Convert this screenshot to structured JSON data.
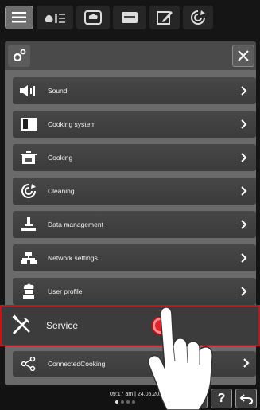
{
  "tabs": [
    {
      "name": "menu-list-tab",
      "active": true
    },
    {
      "name": "cooking-paths-tab",
      "active": false
    },
    {
      "name": "programs-tab",
      "active": false
    },
    {
      "name": "cookbook-tab",
      "active": false
    },
    {
      "name": "edit-tab",
      "active": false
    },
    {
      "name": "cleaning-tab",
      "active": false
    }
  ],
  "menu": {
    "items": [
      {
        "label": "Sound",
        "icon": "speaker-icon"
      },
      {
        "label": "Cooking system",
        "icon": "oven-icon"
      },
      {
        "label": "Cooking",
        "icon": "pot-icon"
      },
      {
        "label": "Cleaning",
        "icon": "cleaning-icon"
      },
      {
        "label": "Data management",
        "icon": "usb-icon"
      },
      {
        "label": "Network settings",
        "icon": "network-icon"
      },
      {
        "label": "User profile",
        "icon": "chef-icon"
      }
    ],
    "service": {
      "label": "Service",
      "icon": "tools-icon"
    },
    "connected": {
      "label": "ConnectedCooking",
      "icon": "share-icon"
    }
  },
  "status": {
    "datetime": "09:17 am | 24.05.2022"
  },
  "colors": {
    "highlight_border": "#c2161b",
    "touch_dot": "#e5232a",
    "panel_bg": "#6a6a6a",
    "item_bg": "#424242"
  }
}
